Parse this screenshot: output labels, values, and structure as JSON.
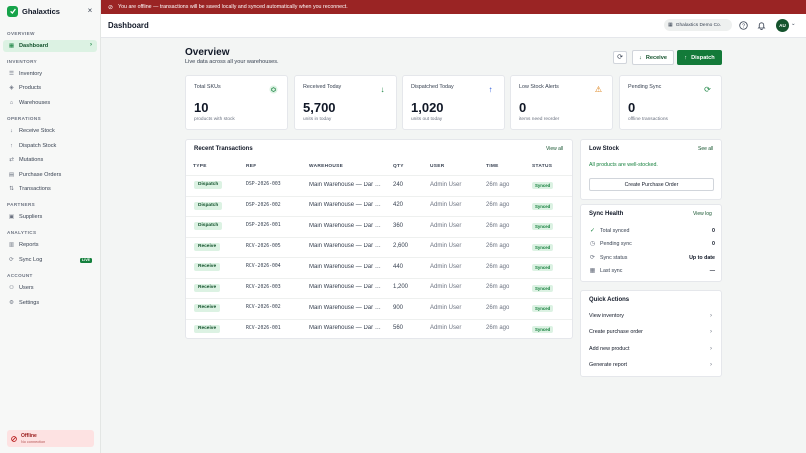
{
  "app": {
    "name": "Ghalaxtics"
  },
  "banner": {
    "text": "You are offline — transactions will be saved locally and synced automatically when you reconnect."
  },
  "header": {
    "title": "Dashboard",
    "org": "Ghalaxtics Demo Co.",
    "avatar": "AU"
  },
  "sidebar": {
    "sections": {
      "overview": "Overview",
      "inventory": "Inventory",
      "operations": "Operations",
      "partners": "Partners",
      "analytics": "Analytics",
      "account": "Account"
    },
    "items": {
      "dashboard": "Dashboard",
      "inventory": "Inventory",
      "products": "Products",
      "warehouses": "Warehouses",
      "receive_stock": "Receive Stock",
      "dispatch_stock": "Dispatch Stock",
      "mutations": "Mutations",
      "purchase_orders": "Purchase Orders",
      "transactions": "Transactions",
      "suppliers": "Suppliers",
      "reports": "Reports",
      "sync_log": "Sync Log",
      "users": "Users",
      "settings": "Settings"
    },
    "live_badge": "LIVE",
    "status": {
      "title": "Offline",
      "subtitle": "No connection"
    }
  },
  "overview": {
    "title": "Overview",
    "subtitle": "Live data across all your warehouses.",
    "receive_label": "Receive",
    "dispatch_label": "Dispatch"
  },
  "stats": [
    {
      "label": "Total SKUs",
      "value": "10",
      "sub": "products with stock",
      "icon": "box-icon"
    },
    {
      "label": "Received Today",
      "value": "5,700",
      "sub": "units in today",
      "icon": "arrow-down-icon"
    },
    {
      "label": "Dispatched Today",
      "value": "1,020",
      "sub": "units out today",
      "icon": "arrow-up-icon"
    },
    {
      "label": "Low Stock Alerts",
      "value": "0",
      "sub": "items need reorder",
      "icon": "warning-icon"
    },
    {
      "label": "Pending Sync",
      "value": "0",
      "sub": "offline transactions",
      "icon": "sync-icon"
    }
  ],
  "transactions": {
    "title": "Recent Transactions",
    "view_all": "View all",
    "columns": [
      "TYPE",
      "REF",
      "WAREHOUSE",
      "QTY",
      "USER",
      "TIME",
      "STATUS"
    ],
    "rows": [
      {
        "type": "Dispatch",
        "ref": "DSP-2026-003",
        "warehouse": "Main Warehouse — Dar es Salaam",
        "qty": "240",
        "user": "Admin User",
        "time": "26m ago",
        "status": "Synced"
      },
      {
        "type": "Dispatch",
        "ref": "DSP-2026-002",
        "warehouse": "Main Warehouse — Dar es Salaam",
        "qty": "420",
        "user": "Admin User",
        "time": "26m ago",
        "status": "Synced"
      },
      {
        "type": "Dispatch",
        "ref": "DSP-2026-001",
        "warehouse": "Main Warehouse — Dar es Salaam",
        "qty": "360",
        "user": "Admin User",
        "time": "26m ago",
        "status": "Synced"
      },
      {
        "type": "Receive",
        "ref": "RCV-2026-005",
        "warehouse": "Main Warehouse — Dar es Salaam",
        "qty": "2,600",
        "user": "Admin User",
        "time": "26m ago",
        "status": "Synced"
      },
      {
        "type": "Receive",
        "ref": "RCV-2026-004",
        "warehouse": "Main Warehouse — Dar es Salaam",
        "qty": "440",
        "user": "Admin User",
        "time": "26m ago",
        "status": "Synced"
      },
      {
        "type": "Receive",
        "ref": "RCV-2026-003",
        "warehouse": "Main Warehouse — Dar es Salaam",
        "qty": "1,200",
        "user": "Admin User",
        "time": "26m ago",
        "status": "Synced"
      },
      {
        "type": "Receive",
        "ref": "RCV-2026-002",
        "warehouse": "Main Warehouse — Dar es Salaam",
        "qty": "900",
        "user": "Admin User",
        "time": "26m ago",
        "status": "Synced"
      },
      {
        "type": "Receive",
        "ref": "RCV-2026-001",
        "warehouse": "Main Warehouse — Dar es Salaam",
        "qty": "560",
        "user": "Admin User",
        "time": "26m ago",
        "status": "Synced"
      }
    ]
  },
  "low_stock": {
    "title": "Low Stock",
    "see_all": "See all",
    "message": "All products are well-stocked.",
    "button": "Create Purchase Order"
  },
  "sync_health": {
    "title": "Sync Health",
    "view_log": "View log",
    "rows": [
      {
        "label": "Total synced",
        "value": "0",
        "icon": "check-circle-icon"
      },
      {
        "label": "Pending sync",
        "value": "0",
        "icon": "clock-icon"
      },
      {
        "label": "Sync status",
        "value": "Up to date",
        "icon": "sync-icon"
      },
      {
        "label": "Last sync",
        "value": "—",
        "icon": "calendar-icon"
      }
    ]
  },
  "quick_actions": {
    "title": "Quick Actions",
    "items": [
      "View inventory",
      "Create purchase order",
      "Add new product",
      "Generate report"
    ]
  }
}
